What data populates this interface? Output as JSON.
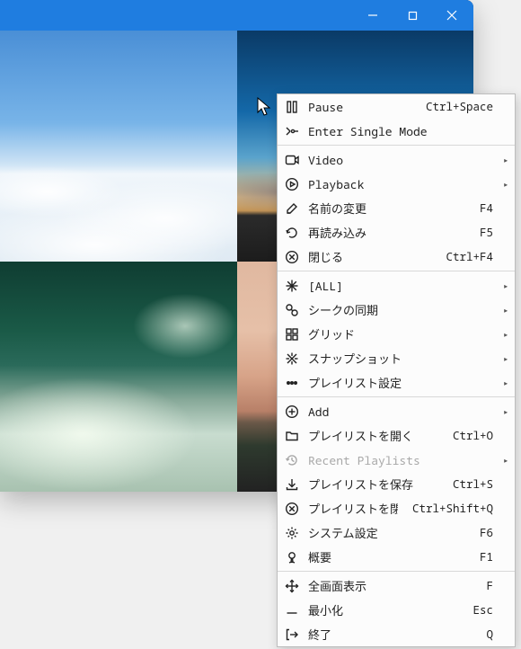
{
  "menu": {
    "items": [
      {
        "icon": "pause-icon",
        "label": "Pause",
        "shortcut": "Ctrl+Space",
        "submenu": false
      },
      {
        "icon": "single-mode-icon",
        "label": "Enter Single Mode",
        "shortcut": "",
        "submenu": false
      },
      {
        "sep": true
      },
      {
        "icon": "video-icon",
        "label": "Video",
        "shortcut": "",
        "submenu": true
      },
      {
        "icon": "playback-icon",
        "label": "Playback",
        "shortcut": "",
        "submenu": true
      },
      {
        "icon": "rename-icon",
        "label": "名前の変更",
        "shortcut": "F4",
        "submenu": false
      },
      {
        "icon": "reload-icon",
        "label": "再読み込み",
        "shortcut": "F5",
        "submenu": false
      },
      {
        "icon": "close-x-icon",
        "label": "閉じる",
        "shortcut": "Ctrl+F4",
        "submenu": false
      },
      {
        "sep": true
      },
      {
        "icon": "all-icon",
        "label": "[ALL]",
        "shortcut": "",
        "submenu": true
      },
      {
        "icon": "seek-sync-icon",
        "label": "シークの同期",
        "shortcut": "",
        "submenu": true
      },
      {
        "icon": "grid-icon",
        "label": "グリッド",
        "shortcut": "",
        "submenu": true
      },
      {
        "icon": "snapshot-icon",
        "label": "スナップショット",
        "shortcut": "",
        "submenu": true
      },
      {
        "icon": "playlist-settings-icon",
        "label": "プレイリスト設定",
        "shortcut": "",
        "submenu": true
      },
      {
        "sep": true
      },
      {
        "icon": "add-icon",
        "label": "Add",
        "shortcut": "",
        "submenu": true
      },
      {
        "icon": "open-playlist-icon",
        "label": "プレイリストを開く",
        "shortcut": "Ctrl+O",
        "submenu": false
      },
      {
        "icon": "recent-icon",
        "label": "Recent Playlists",
        "shortcut": "",
        "submenu": true,
        "disabled": true
      },
      {
        "icon": "save-playlist-icon",
        "label": "プレイリストを保存",
        "shortcut": "Ctrl+S",
        "submenu": false
      },
      {
        "icon": "close-playlist-icon",
        "label": "プレイリストを閉じる",
        "shortcut": "Ctrl+Shift+Q",
        "submenu": false
      },
      {
        "icon": "settings-icon",
        "label": "システム設定",
        "shortcut": "F6",
        "submenu": false
      },
      {
        "icon": "about-icon",
        "label": "概要",
        "shortcut": "F1",
        "submenu": false
      },
      {
        "sep": true
      },
      {
        "icon": "fullscreen-icon",
        "label": "全画面表示",
        "shortcut": "F",
        "submenu": false
      },
      {
        "icon": "minimize-icon",
        "label": "最小化",
        "shortcut": "Esc",
        "submenu": false
      },
      {
        "icon": "quit-icon",
        "label": "終了",
        "shortcut": "Q",
        "submenu": false
      }
    ]
  }
}
